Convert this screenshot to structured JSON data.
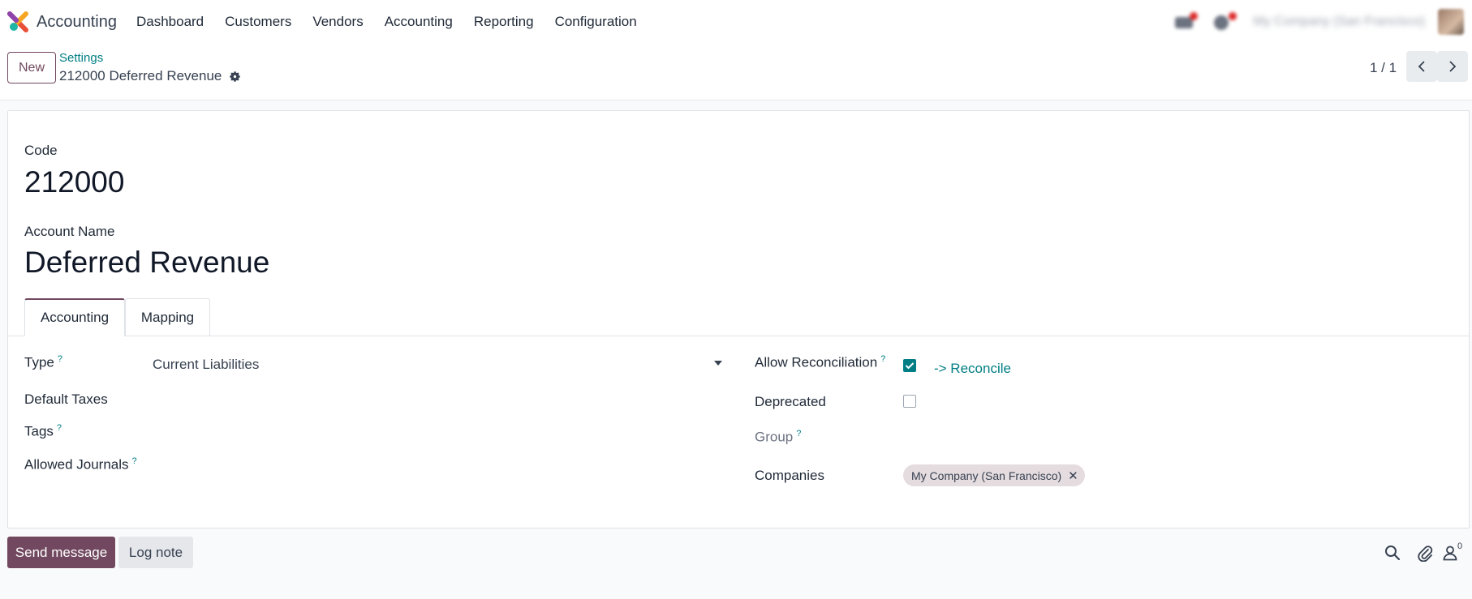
{
  "navbar": {
    "app_name": "Accounting",
    "menu": [
      "Dashboard",
      "Customers",
      "Vendors",
      "Accounting",
      "Reporting",
      "Configuration"
    ],
    "company_switcher": "My Company (San Francisco)"
  },
  "control_panel": {
    "new_label": "New",
    "breadcrumb_parent": "Settings",
    "record_title": "212000 Deferred Revenue",
    "pager": "1 / 1"
  },
  "form": {
    "code_label": "Code",
    "code_value": "212000",
    "name_label": "Account Name",
    "name_value": "Deferred Revenue",
    "tabs": [
      "Accounting",
      "Mapping"
    ],
    "active_tab": "Accounting",
    "help_mark": "?",
    "left": {
      "type_label": "Type",
      "type_value": "Current Liabilities",
      "default_taxes_label": "Default Taxes",
      "tags_label": "Tags",
      "allowed_journals_label": "Allowed Journals"
    },
    "right": {
      "allow_reconciliation_label": "Allow Reconciliation",
      "allow_reconciliation_checked": true,
      "reconcile_link": "-> Reconcile",
      "deprecated_label": "Deprecated",
      "deprecated_checked": false,
      "group_label": "Group",
      "companies_label": "Companies",
      "companies_tags": [
        "My Company (San Francisco)"
      ]
    }
  },
  "chatter": {
    "send_message_label": "Send message",
    "log_note_label": "Log note",
    "followers_count": "0"
  },
  "colors": {
    "primary": "#71485f",
    "link": "#017e84",
    "background": "#f9fafb"
  }
}
